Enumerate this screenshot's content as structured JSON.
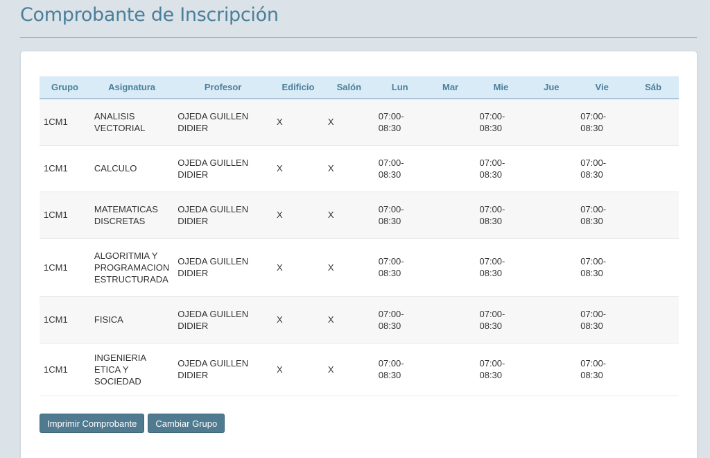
{
  "page": {
    "title": "Comprobante de Inscripción"
  },
  "table": {
    "headers": [
      "Grupo",
      "Asignatura",
      "Profesor",
      "Edificio",
      "Salón",
      "Lun",
      "Mar",
      "Mie",
      "Jue",
      "Vie",
      "Sáb"
    ],
    "rows": [
      [
        "1CM1",
        "ANALISIS VECTORIAL",
        "OJEDA GUILLEN DIDIER",
        "X",
        "X",
        "07:00-08:30",
        "",
        "07:00-08:30",
        "",
        "07:00-08:30",
        ""
      ],
      [
        "1CM1",
        "CALCULO",
        "OJEDA GUILLEN DIDIER",
        "X",
        "X",
        "07:00-08:30",
        "",
        "07:00-08:30",
        "",
        "07:00-08:30",
        ""
      ],
      [
        "1CM1",
        "MATEMATICAS DISCRETAS",
        "OJEDA GUILLEN DIDIER",
        "X",
        "X",
        "07:00-08:30",
        "",
        "07:00-08:30",
        "",
        "07:00-08:30",
        ""
      ],
      [
        "1CM1",
        "ALGORITMIA Y PROGRAMACION ESTRUCTURADA",
        "OJEDA GUILLEN DIDIER",
        "X",
        "X",
        "07:00-08:30",
        "",
        "07:00-08:30",
        "",
        "07:00-08:30",
        ""
      ],
      [
        "1CM1",
        "FISICA",
        "OJEDA GUILLEN DIDIER",
        "X",
        "X",
        "07:00-08:30",
        "",
        "07:00-08:30",
        "",
        "07:00-08:30",
        ""
      ],
      [
        "1CM1",
        "INGENIERIA ETICA Y SOCIEDAD",
        "OJEDA GUILLEN DIDIER",
        "X",
        "X",
        "07:00-08:30",
        "",
        "07:00-08:30",
        "",
        "07:00-08:30",
        ""
      ]
    ]
  },
  "actions": {
    "print_label": "Imprimir Comprobante",
    "change_group_label": "Cambiar Grupo"
  }
}
